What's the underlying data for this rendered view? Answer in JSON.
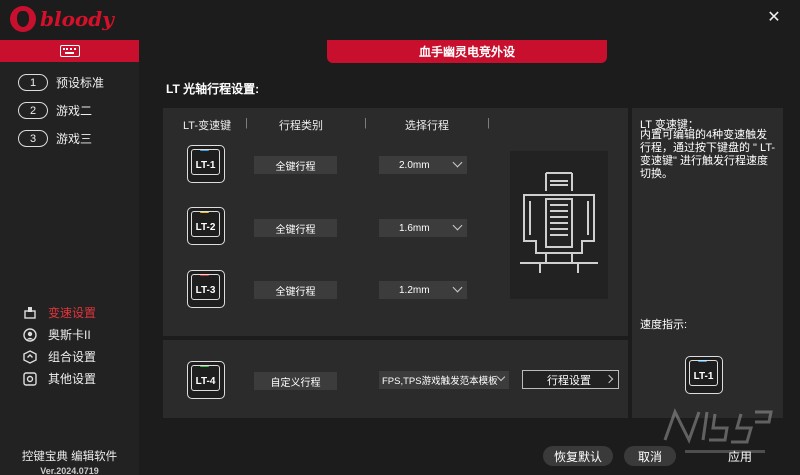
{
  "app": {
    "brand": "bloody",
    "close_glyph": "✕"
  },
  "sidebar": {
    "profiles": [
      {
        "num": "1",
        "label": "预设标准"
      },
      {
        "num": "2",
        "label": "游戏二"
      },
      {
        "num": "3",
        "label": "游戏三"
      }
    ],
    "menu": [
      {
        "label": "变速设置",
        "icon": "switch-icon",
        "active": true
      },
      {
        "label": "奥斯卡II",
        "icon": "oscar-icon",
        "active": false
      },
      {
        "label": "组合设置",
        "icon": "combo-icon",
        "active": false
      },
      {
        "label": "其他设置",
        "icon": "gear-icon",
        "active": false
      }
    ],
    "footer_title": "控键宝典 编辑软件",
    "footer_version": "Ver.2024.0719"
  },
  "header": {
    "tab_title": "血手幽灵电竞外设"
  },
  "section": {
    "title": "LT 光轴行程设置:"
  },
  "table": {
    "col1": "LT-变速键",
    "col2": "行程类别",
    "col3": "选择行程",
    "sep": "|"
  },
  "rows": [
    {
      "key": "LT-1",
      "led": "#3aa0e8",
      "type": "全键行程",
      "travel": "2.0mm"
    },
    {
      "key": "LT-2",
      "led": "#f0c020",
      "type": "全键行程",
      "travel": "1.6mm"
    },
    {
      "key": "LT-3",
      "led": "#e02828",
      "type": "全键行程",
      "travel": "1.2mm"
    }
  ],
  "custom_row": {
    "key": "LT-4",
    "led": "#3cc040",
    "type": "自定义行程",
    "template": "FPS,TPS游戏触发范本模板",
    "button": "行程设置"
  },
  "info": {
    "title": "LT 变速键：",
    "body": "内置可编辑的4种变速触发行程，通过按下键盘的 \" LT-变速键\" 进行触发行程速度切换。",
    "speed_label": "速度指示:",
    "speed_key": "LT-1",
    "speed_led": "#3aa0e8"
  },
  "footer": {
    "reset": "恢复默认",
    "cancel": "取消",
    "apply": "应用"
  },
  "colors": {
    "accent": "#c8102e",
    "panel": "#2b2b2b",
    "bg": "#1c1c1c"
  }
}
